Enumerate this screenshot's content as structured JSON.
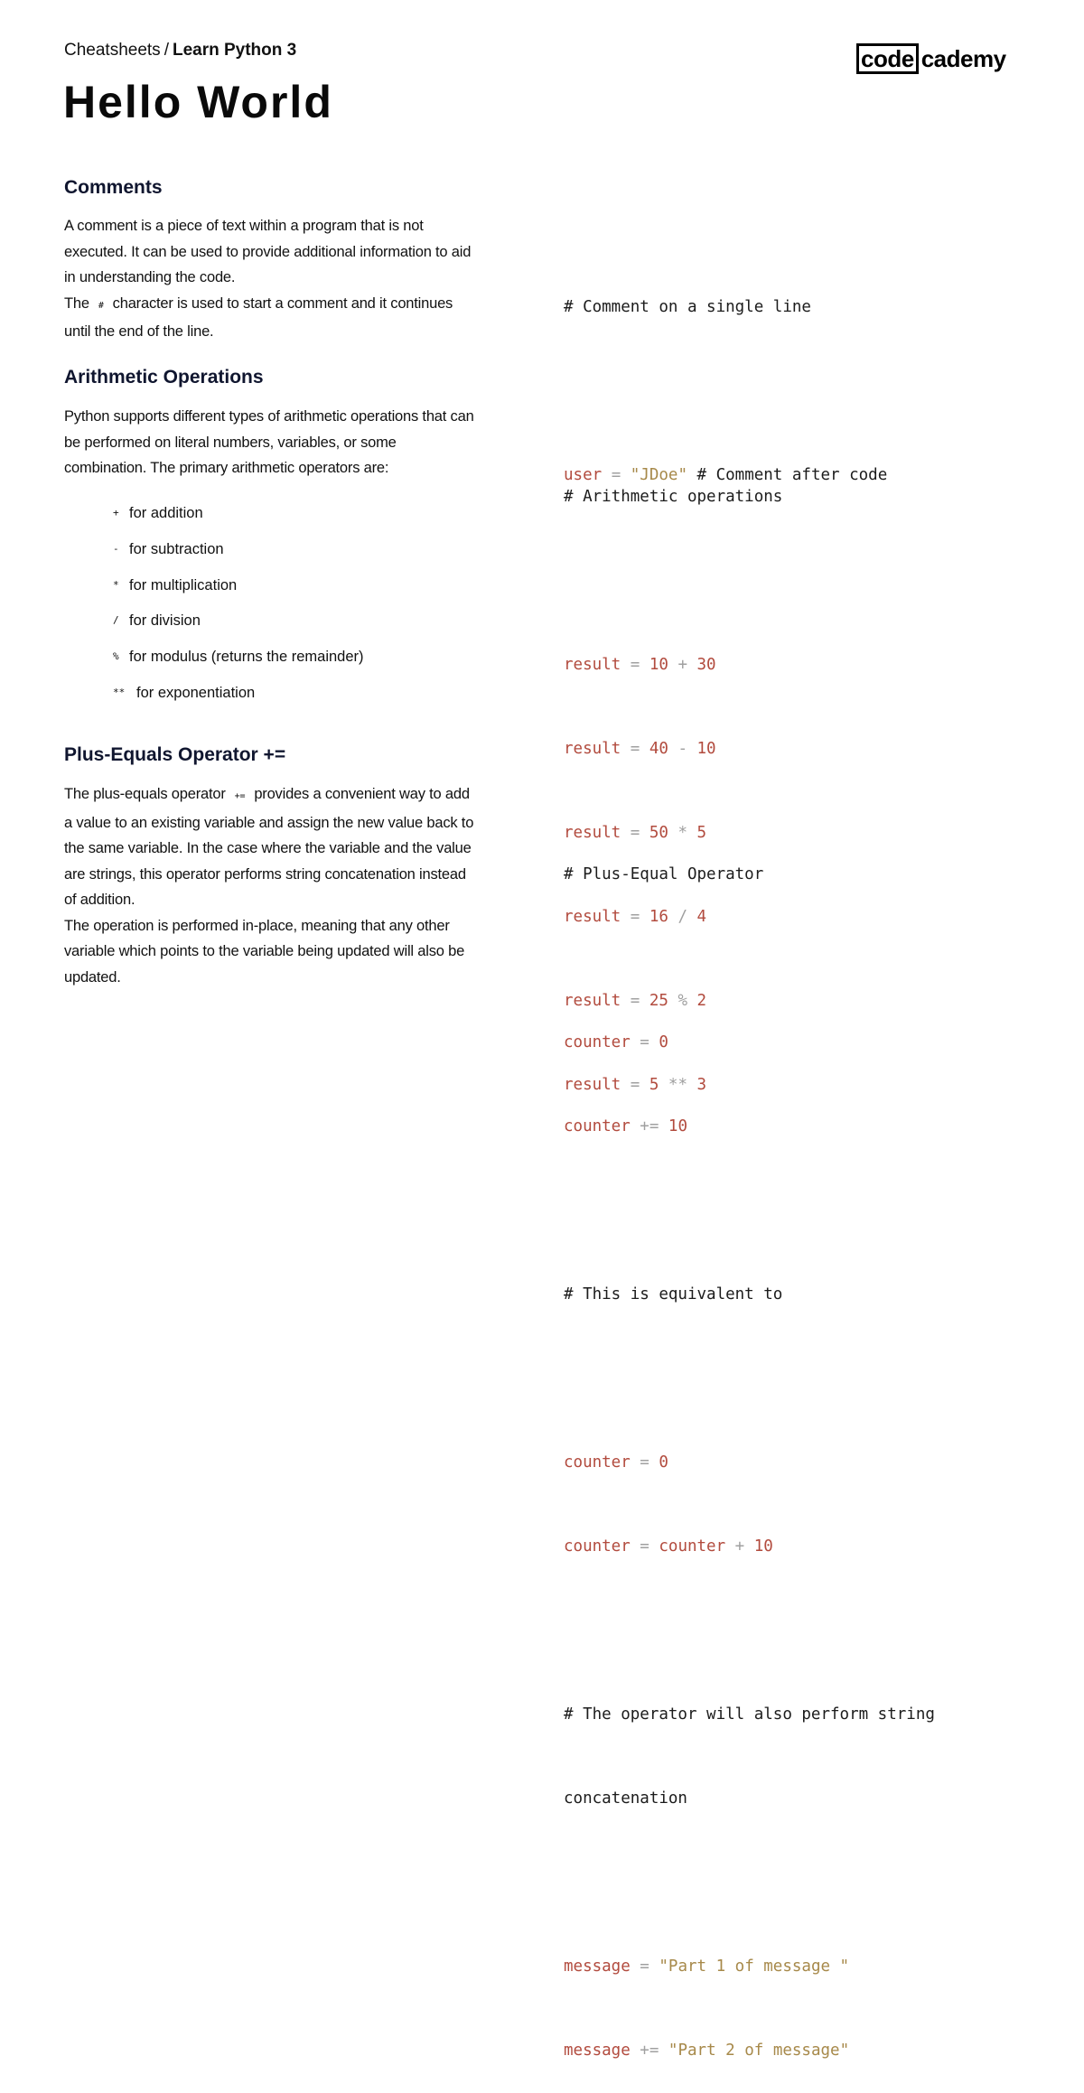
{
  "header": {
    "breadcrumb_root": "Cheatsheets",
    "breadcrumb_separator": "/",
    "breadcrumb_current": "Learn Python 3",
    "title": "Hello World",
    "logo_boxed": "code",
    "logo_rest": "cademy"
  },
  "sections": {
    "comments": {
      "heading": "Comments",
      "para1": "A comment is a piece of text within a program that is not executed. It can be used to provide additional information to aid in understanding the code.",
      "para2_before": "The",
      "para2_code": "#",
      "para2_after": "character is used to start a comment and it continues until the end of the line.",
      "code": {
        "l1": "# Comment on a single line",
        "l2_var": "user",
        "l2_op": " = ",
        "l2_str": "\"JDoe\"",
        "l2_cmt": " # Comment after code"
      }
    },
    "arithmetic": {
      "heading": "Arithmetic Operations",
      "para": "Python supports different types of arithmetic operations that can be performed on literal numbers, variables, or some combination. The primary arithmetic operators are:",
      "operators": [
        {
          "symbol": "+",
          "label": "for addition"
        },
        {
          "symbol": "-",
          "label": "for subtraction"
        },
        {
          "symbol": "*",
          "label": "for multiplication"
        },
        {
          "symbol": "/",
          "label": "for division"
        },
        {
          "symbol": "%",
          "label": "for modulus (returns the remainder)"
        },
        {
          "symbol": "**",
          "label": "for exponentiation"
        }
      ],
      "code": {
        "comment": "# Arithmetic operations",
        "lines": [
          {
            "var": "result",
            "eq": " = ",
            "a": "10",
            "op": " + ",
            "b": "30"
          },
          {
            "var": "result",
            "eq": " = ",
            "a": "40",
            "op": " - ",
            "b": "10"
          },
          {
            "var": "result",
            "eq": " = ",
            "a": "50",
            "op": " * ",
            "b": "5"
          },
          {
            "var": "result",
            "eq": " = ",
            "a": "16",
            "op": " / ",
            "b": "4"
          },
          {
            "var": "result",
            "eq": " = ",
            "a": "25",
            "op": " % ",
            "b": "2"
          },
          {
            "var": "result",
            "eq": " = ",
            "a": "5",
            "op": " ** ",
            "b": "3"
          }
        ]
      }
    },
    "plus_equals": {
      "heading": "Plus-Equals Operator +=",
      "para1_before": "The plus-equals operator",
      "para1_code": "+=",
      "para1_after": "provides a convenient way to add a value to an existing variable and assign the new value back to the same variable. In the case where the variable and the value are strings, this operator performs string concatenation instead of addition.",
      "para2": "The operation is performed in-place, meaning that any other variable which points to the variable being updated will also be updated.",
      "code": {
        "c1": "# Plus-Equal Operator",
        "a_var": "counter",
        "a_op": " = ",
        "a_val": "0",
        "b_var": "counter",
        "b_op": " += ",
        "b_val": "10",
        "c2": "# This is equivalent to",
        "d_var": "counter",
        "d_op": " = ",
        "d_val": "0",
        "e_var": "counter",
        "e_op": " = ",
        "e_var2": "counter",
        "e_op2": " + ",
        "e_val": "10",
        "c3a": "# The operator will also perform string",
        "c3b": "concatenation",
        "f_var": "message",
        "f_op": " = ",
        "f_str": "\"Part 1 of message \"",
        "g_var": "message",
        "g_op": " += ",
        "g_str": "\"Part 2 of message\""
      }
    }
  }
}
